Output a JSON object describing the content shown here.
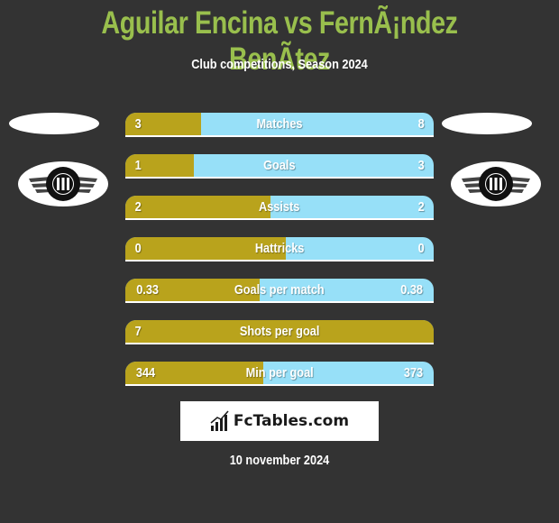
{
  "header": {
    "title": "Aguilar Encina vs FernÃ¡ndez BenÃtez",
    "subtitle": "Club competitions, Season 2024"
  },
  "players": {
    "left": {
      "badge": "club-crest"
    },
    "right": {
      "badge": "club-crest"
    }
  },
  "colors": {
    "background": "#333333",
    "title": "#99bf4d",
    "left_bar": "#b9a31c",
    "right_bar": "#97e0f8"
  },
  "stats": [
    {
      "label": "Matches",
      "left": "3",
      "right": "8",
      "left_fraction": 0.245
    },
    {
      "label": "Goals",
      "left": "1",
      "right": "3",
      "left_fraction": 0.222
    },
    {
      "label": "Assists",
      "left": "2",
      "right": "2",
      "left_fraction": 0.47
    },
    {
      "label": "Hattricks",
      "left": "0",
      "right": "0",
      "left_fraction": 0.52
    },
    {
      "label": "Goals per match",
      "left": "0.33",
      "right": "0.38",
      "left_fraction": 0.435
    },
    {
      "label": "Shots per goal",
      "left": "7",
      "right": "",
      "left_fraction": 1.0
    },
    {
      "label": "Min per goal",
      "left": "344",
      "right": "373",
      "left_fraction": 0.447
    }
  ],
  "footer": {
    "brand": "FcTables.com",
    "date": "10 november 2024"
  }
}
